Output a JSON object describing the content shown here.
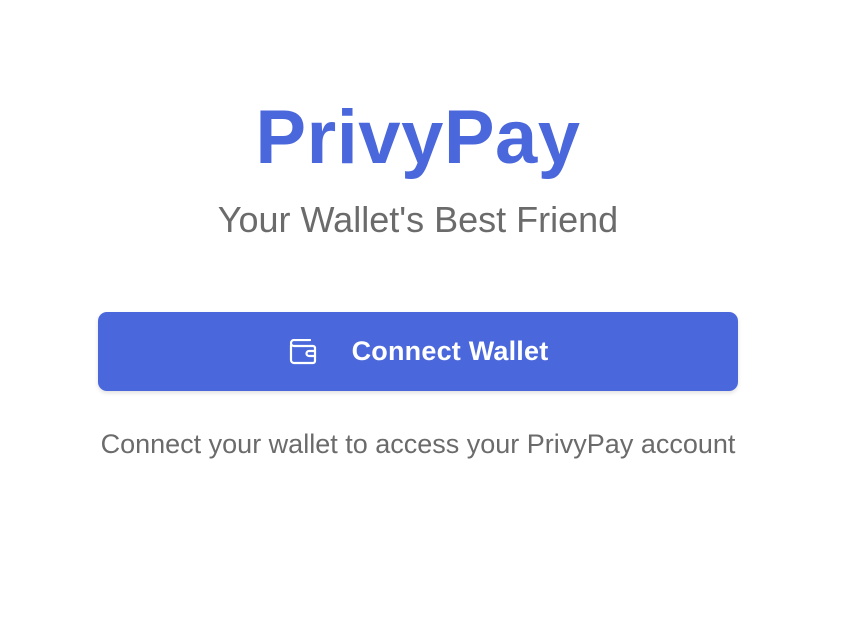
{
  "app": {
    "brand": "PrivyPay",
    "tagline": "Your Wallet's Best Friend"
  },
  "connect": {
    "button_label": "Connect Wallet",
    "button_icon": "wallet-icon",
    "hint": "Connect your wallet to access your PrivyPay account"
  },
  "colors": {
    "accent": "#4a67db",
    "muted_text": "#6b6b6b",
    "background": "#ffffff"
  }
}
